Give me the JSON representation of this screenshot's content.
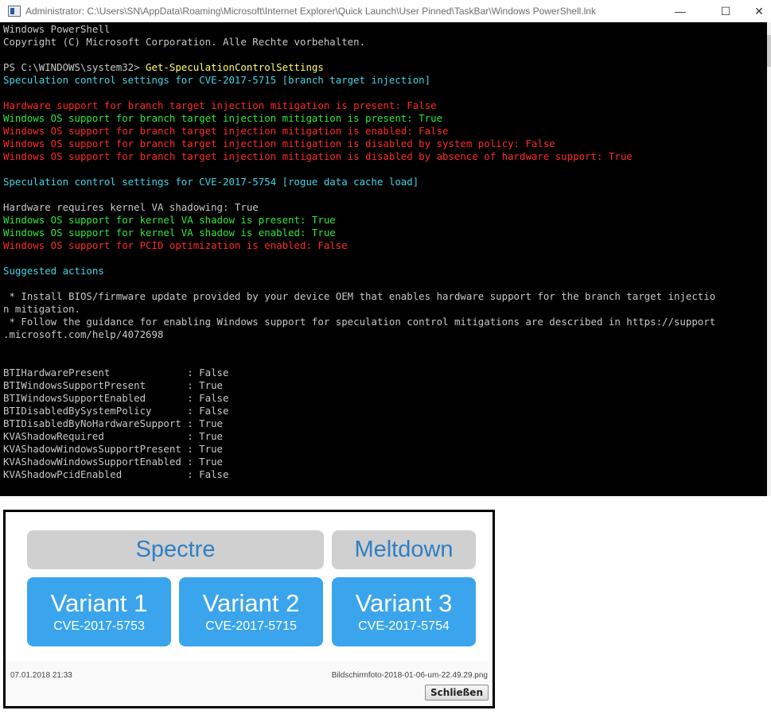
{
  "window": {
    "title": "Administrator: C:\\Users\\SN\\AppData\\Roaming\\Microsoft\\Internet Explorer\\Quick Launch\\User Pinned\\TaskBar\\Windows PowerShell.lnk",
    "controls": {
      "minimize": "—",
      "maximize": "☐",
      "close": "✕"
    }
  },
  "console": {
    "lines": [
      {
        "color": "white",
        "text": "Windows PowerShell"
      },
      {
        "color": "white",
        "text": "Copyright (C) Microsoft Corporation. Alle Rechte vorbehalten."
      },
      {
        "color": "white",
        "text": ""
      },
      {
        "color": "white",
        "text": "PS C:\\WINDOWS\\system32> ",
        "command": "Get-SpeculationControlSettings"
      },
      {
        "color": "cyan",
        "text": "Speculation control settings for CVE-2017-5715 [branch target injection]"
      },
      {
        "color": "white",
        "text": ""
      },
      {
        "color": "red",
        "text": "Hardware support for branch target injection mitigation is present: False"
      },
      {
        "color": "green",
        "text": "Windows OS support for branch target injection mitigation is present: True"
      },
      {
        "color": "red",
        "text": "Windows OS support for branch target injection mitigation is enabled: False"
      },
      {
        "color": "red",
        "text": "Windows OS support for branch target injection mitigation is disabled by system policy: False"
      },
      {
        "color": "red",
        "text": "Windows OS support for branch target injection mitigation is disabled by absence of hardware support: True"
      },
      {
        "color": "white",
        "text": ""
      },
      {
        "color": "cyan",
        "text": "Speculation control settings for CVE-2017-5754 [rogue data cache load]"
      },
      {
        "color": "white",
        "text": ""
      },
      {
        "color": "white",
        "text": "Hardware requires kernel VA shadowing: True"
      },
      {
        "color": "green",
        "text": "Windows OS support for kernel VA shadow is present: True"
      },
      {
        "color": "green",
        "text": "Windows OS support for kernel VA shadow is enabled: True"
      },
      {
        "color": "red",
        "text": "Windows OS support for PCID optimization is enabled: False"
      },
      {
        "color": "white",
        "text": ""
      },
      {
        "color": "cyan",
        "text": "Suggested actions"
      },
      {
        "color": "white",
        "text": ""
      },
      {
        "color": "white",
        "text": " * Install BIOS/firmware update provided by your device OEM that enables hardware support for the branch target injectio"
      },
      {
        "color": "white",
        "text": "n mitigation."
      },
      {
        "color": "white",
        "text": " * Follow the guidance for enabling Windows support for speculation control mitigations are described in https://support"
      },
      {
        "color": "white",
        "text": ".microsoft.com/help/4072698"
      },
      {
        "color": "white",
        "text": ""
      },
      {
        "color": "white",
        "text": ""
      },
      {
        "color": "white",
        "text": "BTIHardwarePresent             : False"
      },
      {
        "color": "white",
        "text": "BTIWindowsSupportPresent       : True"
      },
      {
        "color": "white",
        "text": "BTIWindowsSupportEnabled       : False"
      },
      {
        "color": "white",
        "text": "BTIDisabledBySystemPolicy      : False"
      },
      {
        "color": "white",
        "text": "BTIDisabledByNoHardwareSupport : True"
      },
      {
        "color": "white",
        "text": "KVAShadowRequired              : True"
      },
      {
        "color": "white",
        "text": "KVAShadowWindowsSupportPresent : True"
      },
      {
        "color": "white",
        "text": "KVAShadowWindowsSupportEnabled : True"
      },
      {
        "color": "white",
        "text": "KVAShadowPcidEnabled           : False"
      }
    ]
  },
  "viewer": {
    "headers": {
      "spectre": "Spectre",
      "meltdown": "Meltdown"
    },
    "variants": [
      {
        "name": "Variant 1",
        "cve": "CVE-2017-5753"
      },
      {
        "name": "Variant 2",
        "cve": "CVE-2017-5715"
      },
      {
        "name": "Variant 3",
        "cve": "CVE-2017-5754"
      }
    ],
    "date": "07.01.2018 21:33",
    "filename": "Bildschirmfoto-2018-01-06-um-22.49.29.png",
    "close_label": "Schließen"
  },
  "colors": {
    "console_bg": "#000000",
    "header_blue": "#2e7fc4",
    "variant_blue": "#3aa5ec"
  }
}
